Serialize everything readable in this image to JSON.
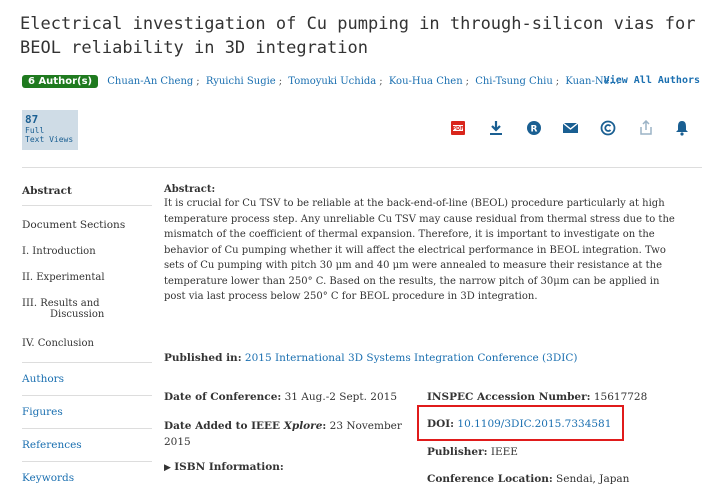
{
  "title": "Electrical investigation of Cu pumping in through-silicon vias for BEOL reliability in 3D integration",
  "authors": {
    "badge": "6 Author(s)",
    "names": [
      "Chuan-An Cheng",
      "Ryuichi Sugie",
      "Tomoyuki Uchida",
      "Kou-Hua Chen",
      "Chi-Tsung Chiu",
      "Kuan-Ne…"
    ],
    "view_all": "View All Authors"
  },
  "views": {
    "count": "87",
    "line1": "Full",
    "line2": "Text Views"
  },
  "toolbar": [
    "pdf-icon",
    "download-icon",
    "registered-icon",
    "mail-icon",
    "copyright-icon",
    "share-icon",
    "bell-icon"
  ],
  "sidebar": {
    "abstract": "Abstract",
    "sections_title": "Document Sections",
    "sections": [
      "I. Introduction",
      "II. Experimental",
      "III. Results and",
      "Discussion",
      "IV. Conclusion"
    ],
    "links": [
      "Authors",
      "Figures",
      "References",
      "Keywords"
    ]
  },
  "abstract": {
    "heading": "Abstract:",
    "text": "It is crucial for Cu TSV to be reliable at the back-end-of-line (BEOL) procedure particularly at high temperature process step. Any unreliable Cu TSV may cause residual from thermal stress due to the mismatch of the coefficient of thermal expansion. Therefore, it is important to investigate on the behavior of Cu pumping whether it will affect the electrical performance in BEOL integration. Two sets of Cu pumping with pitch 30 μm and 40 μm were annealed to measure their resistance at the temperature lower than 250° C. Based on the results, the narrow pitch of 30μm can be applied in post via last process below 250° C for BEOL procedure in 3D integration."
  },
  "published": {
    "label": "Published in:",
    "value": "2015 International 3D Systems Integration Conference (3DIC)"
  },
  "conference_date": {
    "label": "Date of Conference:",
    "value": "31 Aug.-2 Sept. 2015"
  },
  "date_added": {
    "label": "Date Added to IEEE ",
    "label_em": "Xplore",
    "label_end": ":",
    "value": "23 November 2015"
  },
  "isbn": {
    "label": "ISBN Information:"
  },
  "inspec": {
    "label": "INSPEC Accession Number:",
    "value": "15617728"
  },
  "doi": {
    "label": "DOI:",
    "value": "10.1109/3DIC.2015.7334581"
  },
  "publisher": {
    "label": "Publisher:",
    "value": "IEEE"
  },
  "location": {
    "label": "Conference Location:",
    "value": "Sendai, Japan"
  },
  "colors": {
    "link": "#1a6fb0",
    "badge": "#1f7a1f",
    "highlight": "#e01b1b",
    "icon": "#1a5f92",
    "pdf": "#d9261c"
  }
}
